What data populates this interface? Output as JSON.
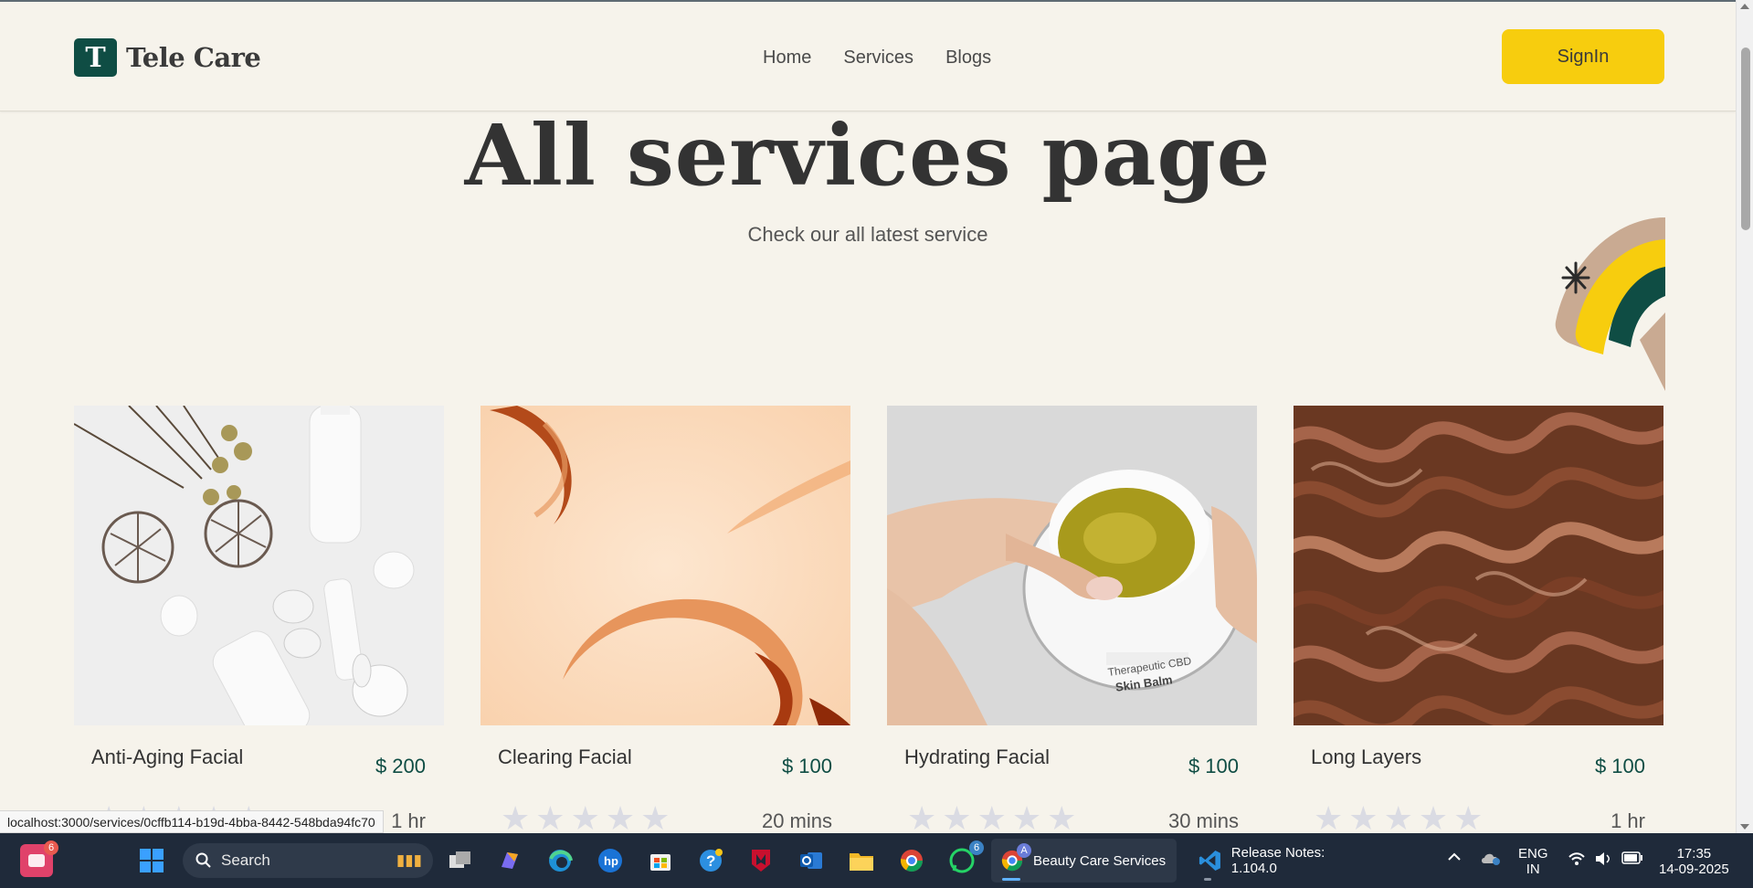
{
  "header": {
    "logo_letter": "T",
    "logo_text": "Tele Care",
    "nav": [
      "Home",
      "Services",
      "Blogs"
    ],
    "signin_label": "SignIn"
  },
  "hero": {
    "title": "All services page",
    "subtitle": "Check our all latest service"
  },
  "services": [
    {
      "title": "Anti-Aging Facial",
      "price": "$ 200",
      "duration": "1 hr",
      "stars": 5
    },
    {
      "title": "Clearing Facial",
      "price": "$ 100",
      "duration": "20 mins",
      "stars": 5
    },
    {
      "title": "Hydrating Facial",
      "price": "$ 100",
      "duration": "30 mins",
      "stars": 5
    },
    {
      "title": "Long Layers",
      "price": "$ 100",
      "duration": "1 hr",
      "stars": 5
    }
  ],
  "status_url": "localhost:3000/services/0cffb114-b19d-4bba-8442-548bda94fc70",
  "taskbar": {
    "search_label": "Search",
    "badge_left": "6",
    "badge_whatsapp": "6",
    "badge_chrome_profile": "A",
    "apps": [
      {
        "label": "Beauty Care Services"
      },
      {
        "label": "Release Notes: 1.104.0"
      }
    ],
    "lang_top": "ENG",
    "lang_bottom": "IN",
    "time": "17:35",
    "date": "14-09-2025"
  },
  "colors": {
    "brand": "#0f4d44",
    "accent": "#f7cd0e",
    "background": "#f6f3eb"
  }
}
